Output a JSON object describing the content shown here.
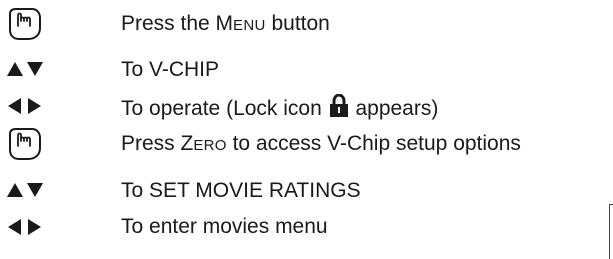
{
  "colors": {
    "ink": "#1a1a1a"
  },
  "steps": [
    {
      "icon": "hand-press-icon",
      "pre": "Press the ",
      "sc": "Menu",
      "sc_first": "M",
      "sc_rest": "ENU",
      "post": " button"
    },
    {
      "icon": "up-down-arrows-icon",
      "text": "To V-CHIP"
    },
    {
      "icon": "left-right-arrows-icon",
      "pre": "To operate (Lock icon ",
      "post": " appears)"
    },
    {
      "icon": "hand-press-icon",
      "pre": "Press ",
      "sc_first": "Z",
      "sc_rest": "ERO",
      "post": " to access V-Chip setup options"
    },
    {
      "icon": "up-down-arrows-icon",
      "text": "To SET MOVIE RATINGS"
    },
    {
      "icon": "left-right-arrows-icon",
      "text": "To enter movies menu"
    }
  ]
}
